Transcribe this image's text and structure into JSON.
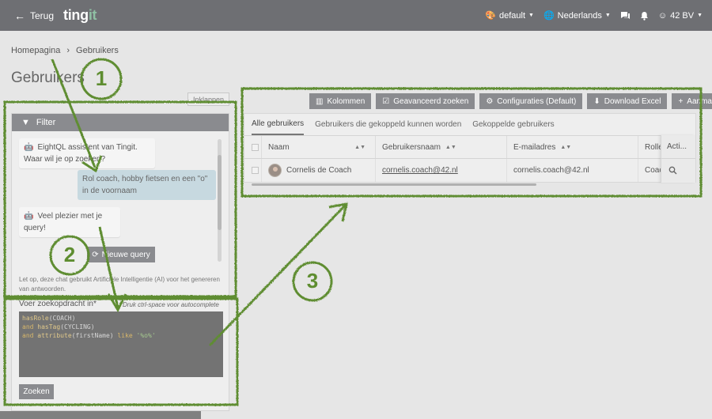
{
  "topbar": {
    "back_label": "Terug",
    "logo_main": "ting",
    "logo_accent": "it",
    "theme_label": "default",
    "language_label": "Nederlands",
    "account_label": "42 BV"
  },
  "breadcrumb": {
    "home": "Homepagina",
    "current": "Gebruikers"
  },
  "page_title": "Gebruikers",
  "collapse_label": "Inklappen",
  "filter": {
    "header": "Filter",
    "messages": [
      {
        "role": "bot",
        "text": "EightQL assistent van Tingit. Waar wil je op zoeken?"
      },
      {
        "role": "user",
        "text": "Rol coach, hobby fietsen en een \"o\" in de voornaam"
      },
      {
        "role": "bot",
        "text": "Veel plezier met je query!"
      }
    ],
    "new_query_label": "Nieuwe query",
    "disclaimer": "Let op, deze chat gebruikt Artificiële Intelligentie (AI) voor het genereren van antwoorden.",
    "query_label": "Voer zoekopdracht in*",
    "query_hint": "Druk ctrl-space voor autocomplete",
    "code": {
      "l1_fn": "hasRole",
      "l1_arg": "(COACH)",
      "l2_kw": "and",
      "l2_fn": "hasTag",
      "l2_arg": "(CYCLING)",
      "l3_kw": "and",
      "l3_fn": "attribute",
      "l3_arg": "(firstName)",
      "l3_op": "like",
      "l3_str": "'%o%'"
    },
    "search_label": "Zoeken"
  },
  "toolbar": {
    "columns": "Kolommen",
    "advanced": "Geavanceerd zoeken",
    "config": "Configuraties (Default)",
    "excel": "Download Excel",
    "add": "Aanmaken"
  },
  "tabs": [
    "Alle gebruikers",
    "Gebruikers die gekoppeld kunnen worden",
    "Gekoppelde gebruikers"
  ],
  "table": {
    "headers": {
      "name": "Naam",
      "username": "Gebruikersnaam",
      "email": "E-mailadres",
      "roles": "Rolle",
      "actions": "Acti..."
    },
    "rows": [
      {
        "name": "Cornelis de Coach",
        "username": "cornelis.coach@42.nl",
        "email": "cornelis.coach@42.nl",
        "roles": "Coac"
      }
    ]
  },
  "annotations": [
    "1",
    "2",
    "3"
  ],
  "colors": {
    "annotation_green": "#5e8d30",
    "topbar": "#6e6f73",
    "button": "#8a8b8f"
  }
}
